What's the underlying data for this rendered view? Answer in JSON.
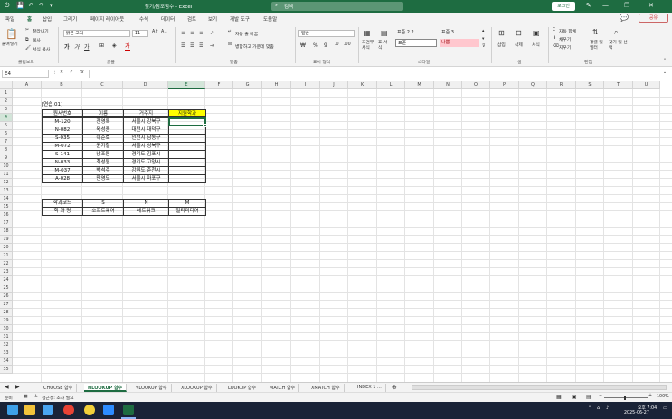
{
  "window": {
    "title": "찾기/참조함수 - Excel",
    "search_placeholder": "검색",
    "login_label": "로그인"
  },
  "menu": {
    "items": [
      "파일",
      "홈",
      "삽입",
      "그리기",
      "페이지 레이아웃",
      "수식",
      "데이터",
      "검토",
      "보기",
      "개발 도구",
      "도움말"
    ],
    "share_label": "공유"
  },
  "ribbon": {
    "paste": "붙여넣기",
    "cut": "잘라내기",
    "copy": "복사",
    "format_painter": "서식 복사",
    "font_name": "맑은 고딕",
    "font_size": "11",
    "wrap_text": "자동 줄 바꿈",
    "merge_center": "병합하고 가운데 맞춤",
    "number_format": "일반",
    "conditional_format": "조건부 서식",
    "table_format": "표 서식",
    "style_normal22": "표준 2 2",
    "style_normal3": "표준 3",
    "style_normal": "표준",
    "style_bad": "나쁨",
    "insert": "삽입",
    "delete": "삭제",
    "format": "서식",
    "autosum": "자동 합계",
    "fill": "채우기",
    "clear": "지우기",
    "sort_filter": "정렬 및 필터",
    "find_select": "찾기 및 선택",
    "groups": {
      "clipboard": "클립보드",
      "font": "글꼴",
      "alignment": "맞춤",
      "number": "표시 형식",
      "styles": "스타일",
      "cells": "셀",
      "editing": "편집"
    }
  },
  "formula_bar": {
    "name_box": "E4",
    "fx": "fx",
    "content": ""
  },
  "grid": {
    "columns": [
      "A",
      "B",
      "C",
      "D",
      "E",
      "F",
      "G",
      "H",
      "I",
      "J",
      "K",
      "L",
      "M",
      "N",
      "O",
      "P",
      "Q",
      "R",
      "S",
      "T",
      "U"
    ],
    "rows": [
      "1",
      "2",
      "3",
      "4",
      "5",
      "6",
      "7",
      "8",
      "9",
      "10",
      "11",
      "12",
      "13",
      "14",
      "15",
      "16",
      "17",
      "18",
      "19",
      "20",
      "21",
      "22",
      "23",
      "24",
      "25",
      "26",
      "27",
      "28",
      "29",
      "30",
      "31",
      "32",
      "33",
      "34",
      "35"
    ],
    "selected_cell": "E4",
    "practice_title": "[연습 01]",
    "table1_headers": [
      "원서번호",
      "이름",
      "거주지",
      "지원학과"
    ],
    "table1_rows": [
      [
        "M-120",
        "전영록",
        "서울시 강북구",
        ""
      ],
      [
        "N-082",
        "육성종",
        "대전시 대덕구",
        ""
      ],
      [
        "S-035",
        "이준호",
        "인천시 남동구",
        ""
      ],
      [
        "M-072",
        "윤기철",
        "서울시 성북구",
        ""
      ],
      [
        "S-141",
        "남조원",
        "경기도 김포시",
        ""
      ],
      [
        "N-033",
        "최성원",
        "경기도 고양시",
        ""
      ],
      [
        "M-037",
        "박석주",
        "강원도 춘천시",
        ""
      ],
      [
        "A-028",
        "민영도",
        "서울시 마포구",
        ""
      ]
    ],
    "table2_rows": [
      [
        "학과코드",
        "S",
        "N",
        "M"
      ],
      [
        "학 과 명",
        "소프트웨어",
        "네트워크",
        "멀티미디어"
      ]
    ],
    "highlight_color": "#ffff00"
  },
  "sheets": {
    "tabs": [
      "CHOOSE 함수",
      "HLOOKUP 함수",
      "VLOOKUP 함수",
      "XLOOKUP 함수",
      "LOOKUP 함수",
      "MATCH 함수",
      "XMATCH 함수",
      "INDEX 1 ..."
    ],
    "active_index": 1
  },
  "status": {
    "ready": "준비",
    "accessibility": "접근성: 조사 필요",
    "zoom": "100%"
  },
  "taskbar": {
    "time": "오후 7:04",
    "date": "2025-06-27"
  },
  "colors": {
    "accent": "#1e6c41",
    "title_bg": "#1e6c41",
    "bad_style_bg": "#ffc7ce",
    "bad_style_fg": "#9c0006"
  }
}
